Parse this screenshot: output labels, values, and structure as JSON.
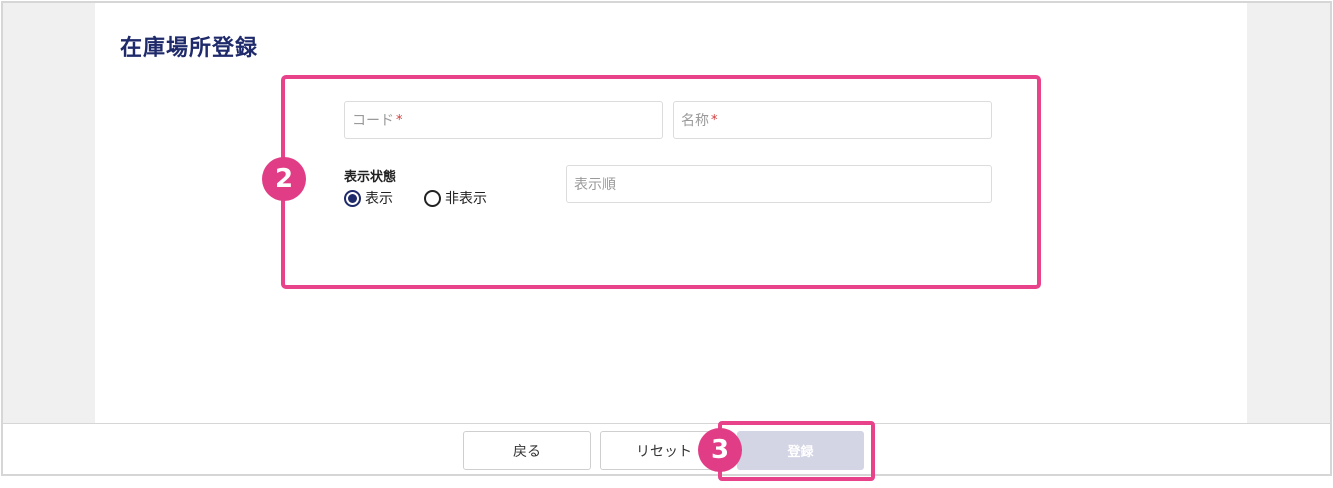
{
  "page": {
    "title": "在庫場所登録"
  },
  "form": {
    "code_placeholder": "コード",
    "name_placeholder": "名称",
    "required_mark": "*",
    "display_status_label": "表示状態",
    "radio_show_label": "表示",
    "radio_hide_label": "非表示",
    "selected": "表示",
    "display_order_placeholder": "表示順"
  },
  "footer": {
    "back_label": "戻る",
    "reset_label": "リセット",
    "submit_label": "登録"
  },
  "annotations": {
    "step_2": "2",
    "step_3": "3"
  },
  "colors": {
    "title": "#1f2a6b",
    "highlight": "#e8428a",
    "badge": "#e13d86",
    "submit_disabled": "#d3d4e4"
  }
}
